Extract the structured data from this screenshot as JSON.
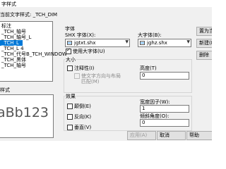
{
  "window": {
    "title": "字样式"
  },
  "current_style": {
    "label": "当前文字样式: _TCH_DIM"
  },
  "style_list": {
    "items": [
      "标注",
      "_TCH_轴号",
      "_TCH_轴号_L",
      "_TCH_L",
      "_TCH_L 4",
      "_TCH_代号B_TCH_WINDOW",
      "_TCH_黑体",
      "_TCH_轴号"
    ],
    "selected_index": 3
  },
  "preview": {
    "label": "样式",
    "sample_text": "aBb123"
  },
  "font": {
    "section_label": "字体",
    "shx_label": "SHX 字体(X):",
    "shx_value": "jgtxt.shx",
    "big_label": "大字体(B):",
    "big_value": "jghz.shx",
    "use_big_label": "使用大字体(U)",
    "use_big_checked": true
  },
  "size": {
    "section_label": "大小",
    "annotative_label": "注释性(I)",
    "annotative_checked": false,
    "match_orientation_line1": "使文字方向与布局",
    "match_orientation_line2": "匹配(M)",
    "height_label": "高度(T)",
    "height_value": "0"
  },
  "effects": {
    "section_label": "效果",
    "upside_down_label": "颠倒(E)",
    "backwards_label": "反向(K)",
    "vertical_label": "垂直(V)",
    "width_factor_label": "宽度因子(W):",
    "width_factor_value": "1",
    "oblique_label": "倾斜角度(O):",
    "oblique_value": "0"
  },
  "buttons": {
    "set_current": "置为当前",
    "new": "新建(N)...",
    "delete": "删除",
    "apply": "应用(A)",
    "cancel": "取消",
    "help": "帮助"
  }
}
